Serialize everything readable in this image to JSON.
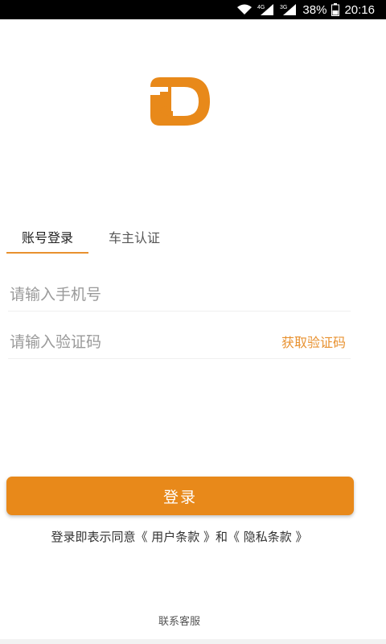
{
  "status_bar": {
    "signal_labels": [
      "4G",
      "3G"
    ],
    "battery_percent": "38%",
    "time": "20:16",
    "icons": [
      "wifi-icon",
      "signal-4g-icon",
      "signal-3g-icon",
      "battery-icon"
    ]
  },
  "logo": {
    "icon": "brand-logo-icon",
    "color": "#E8891A"
  },
  "tabs": [
    {
      "label": "账号登录",
      "active": true
    },
    {
      "label": "车主认证",
      "active": false
    }
  ],
  "form": {
    "phone_placeholder": "请输入手机号",
    "phone_value": "",
    "code_placeholder": "请输入验证码",
    "code_value": "",
    "get_code_label": "获取验证码"
  },
  "login_button_label": "登录",
  "agreement": {
    "prefix": "登录即表示同意",
    "terms_link": "《 用户条款 》",
    "conjunction": "和",
    "privacy_link": "《 隐私条款 》"
  },
  "contact_label": "联系客服",
  "colors": {
    "accent": "#E8891A",
    "text": "#333333",
    "placeholder": "#9A9A9A"
  }
}
